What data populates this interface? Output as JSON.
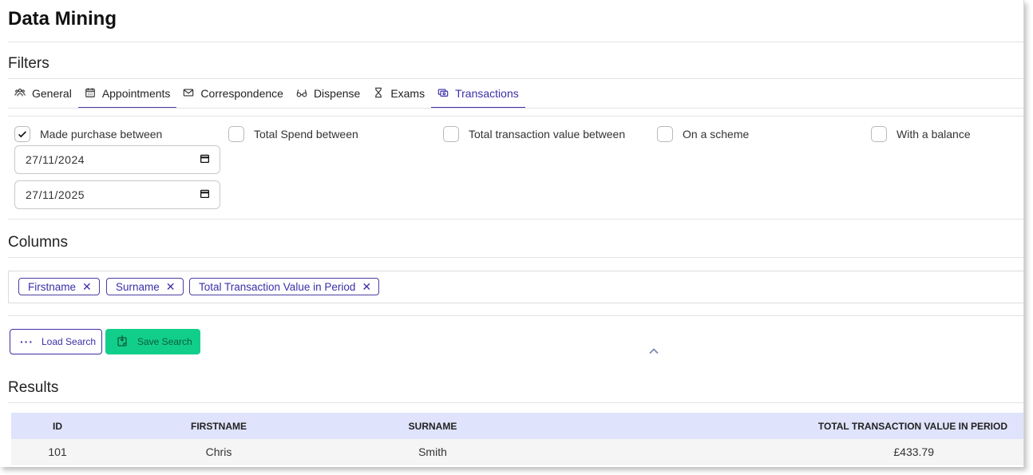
{
  "title": "Data Mining",
  "filters": {
    "heading": "Filters",
    "tabs": [
      {
        "label": "General",
        "icon": "users-icon"
      },
      {
        "label": "Appointments",
        "icon": "calendar-icon"
      },
      {
        "label": "Correspondence",
        "icon": "envelope-icon"
      },
      {
        "label": "Dispense",
        "icon": "glasses-icon"
      },
      {
        "label": "Exams",
        "icon": "hourglass-icon"
      },
      {
        "label": "Transactions",
        "icon": "cash-icon",
        "active": true
      }
    ],
    "checkboxes": [
      {
        "label": "Made purchase between",
        "checked": true
      },
      {
        "label": "Total Spend between",
        "checked": false
      },
      {
        "label": "Total transaction value between",
        "checked": false
      },
      {
        "label": "On a scheme",
        "checked": false
      },
      {
        "label": "With a balance",
        "checked": false
      }
    ],
    "date_from": "27/11/2024",
    "date_to": "27/11/2025"
  },
  "columns": {
    "heading": "Columns",
    "chips": [
      "Firstname",
      "Surname",
      "Total Transaction Value in Period"
    ]
  },
  "actions": {
    "load_label": "Load Search",
    "save_label": "Save Search"
  },
  "results": {
    "heading": "Results",
    "headers": [
      "ID",
      "FIRSTNAME",
      "SURNAME",
      "TOTAL TRANSACTION VALUE IN PERIOD"
    ],
    "rows": [
      [
        "101",
        "Chris",
        "Smith",
        "£433.79"
      ]
    ]
  },
  "colors": {
    "accent": "#3b2fa8",
    "save_button": "#11cf8b",
    "table_header": "#dfe3fb"
  }
}
